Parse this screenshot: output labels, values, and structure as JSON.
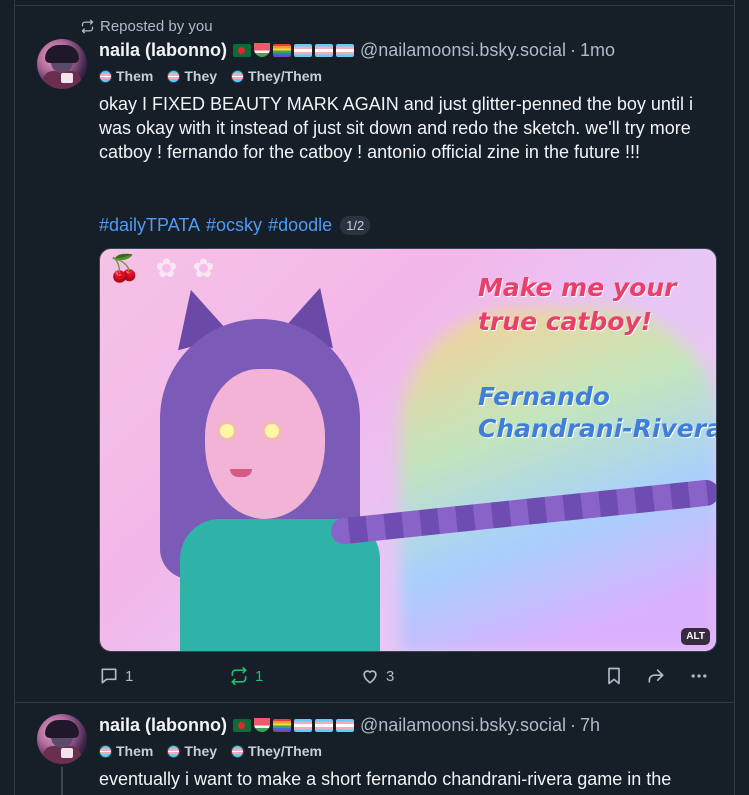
{
  "repost": {
    "label": "Reposted by you"
  },
  "post1": {
    "author": {
      "display_name": "naila (labonno)",
      "handle": "@nailamoonsi.bsky.social",
      "time": "1mo"
    },
    "pronouns": [
      "Them",
      "They",
      "They/Them"
    ],
    "text": "okay I FIXED BEAUTY MARK AGAIN and just glitter-penned the boy until i was okay with it instead of just sit down and redo the sketch. we'll try more catboy ! fernando for the catboy ! antonio official zine in the future !!!",
    "hashtags": [
      "#dailyTPATA",
      "#ocsky",
      "#doodle"
    ],
    "image_count": "1/2",
    "image": {
      "title_line1": "Make me your",
      "title_line2": "true catboy!",
      "name_line1": "Fernando",
      "name_line2": "Chandrani-Rivera",
      "alt_badge": "ALT"
    },
    "actions": {
      "replies": "1",
      "reposts": "1",
      "likes": "3"
    }
  },
  "post2": {
    "author": {
      "display_name": "naila (labonno)",
      "handle": "@nailamoonsi.bsky.social",
      "time": "7h"
    },
    "pronouns": [
      "Them",
      "They",
      "They/Them"
    ],
    "text": "eventually i want to make a short fernando chandrani-rivera game in the"
  },
  "colors": {
    "background": "#161e27",
    "link": "#4f9cf7",
    "repost_active": "#20bc6e",
    "muted": "#aebbc9"
  }
}
